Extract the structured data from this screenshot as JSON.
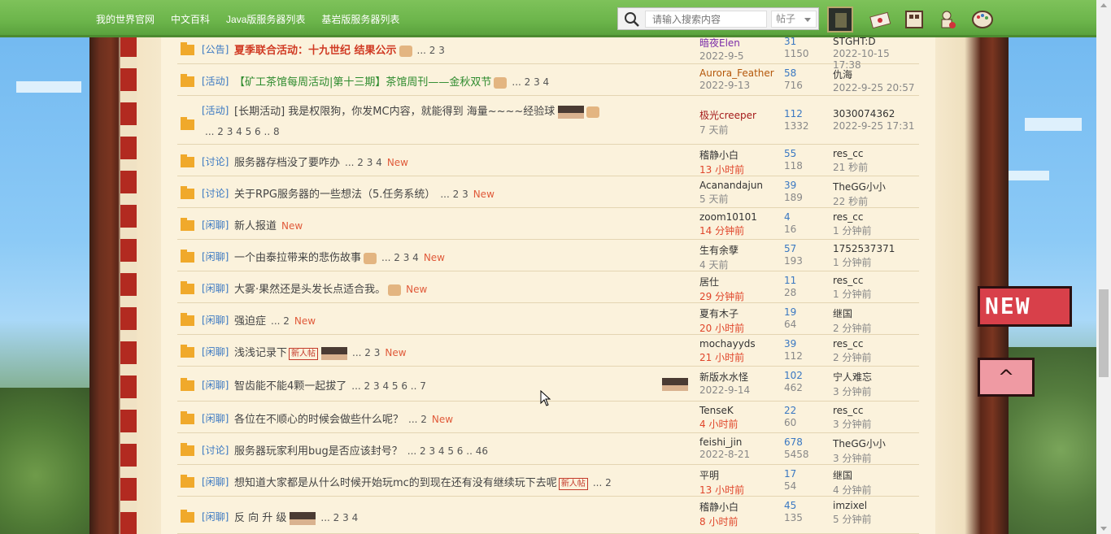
{
  "nav": [
    "我的世界官网",
    "中文百科",
    "Java版服务器列表",
    "基岩版服务器列表"
  ],
  "search": {
    "placeholder": "请输入搜索内容",
    "scope": "帖子"
  },
  "icons": [
    "search-icon",
    "messages-icon",
    "inventory-icon",
    "profile-icon",
    "palette-icon"
  ],
  "flags": {
    "new": "NEW",
    "top": "^"
  },
  "threads": [
    {
      "tag": "[公告]",
      "title": "夏季联合活动：十九世纪 结果公示",
      "style": "red",
      "pages": "... 2 3",
      "author": "暗夜Elen",
      "date": "2022-9-5",
      "replies": "31",
      "views": "1150",
      "last_user": "STGHT:D",
      "last_time": "2022-10-15 17:38"
    },
    {
      "tag": "[活动]",
      "title": "【矿工茶馆每周活动|第十三期】茶馆周刊——金秋双节",
      "style": "green",
      "pages": "... 2 3 4",
      "author": "Aurora_Feather",
      "date": "2022-9-13",
      "replies": "58",
      "views": "716",
      "last_user": "仇海",
      "last_time": "2022-9-25 20:57"
    },
    {
      "tag": "[活动]",
      "title": "[长期活动] 我是权限狗，你发MC内容，就能得到 海量~~~~经验球",
      "style": "",
      "pages": "... 2 3 4 5 6 .. 8",
      "author": "极光creeper",
      "date": "7 天前",
      "replies": "112",
      "views": "1332",
      "last_user": "3030074362",
      "last_time": "2022-9-25 17:31"
    },
    {
      "tag": "[讨论]",
      "title": "服务器存档没了要咋办",
      "style": "",
      "pages": "... 2 3 4",
      "new": "New",
      "author": "稽静小白",
      "date": "13 小时前",
      "replies": "55",
      "views": "118",
      "last_user": "res_cc",
      "last_time": "21 秒前"
    },
    {
      "tag": "[讨论]",
      "title": "关于RPG服务器的一些想法（5.任务系统）",
      "style": "",
      "pages": "... 2 3",
      "new": "New",
      "author": "Acanandajun",
      "date": "5 天前",
      "replies": "39",
      "views": "189",
      "last_user": "TheGG小小",
      "last_time": "22 秒前"
    },
    {
      "tag": "[闲聊]",
      "title": "新人报道",
      "style": "",
      "pages": "",
      "new": "New",
      "author": "zoom10101",
      "date": "14 分钟前",
      "replies": "4",
      "views": "16",
      "last_user": "res_cc",
      "last_time": "1 分钟前"
    },
    {
      "tag": "[闲聊]",
      "title": "一个由泰拉带来的悲伤故事",
      "style": "",
      "pages": "... 2 3 4",
      "new": "New",
      "author": "生有余孽",
      "date": "4 天前",
      "replies": "57",
      "views": "193",
      "last_user": "1752537371",
      "last_time": "1 分钟前"
    },
    {
      "tag": "[闲聊]",
      "title": "大雾·果然还是头发长点适合我。",
      "style": "",
      "pages": "",
      "new": "New",
      "author": "居仕",
      "date": "29 分钟前",
      "replies": "11",
      "views": "28",
      "last_user": "res_cc",
      "last_time": "1 分钟前"
    },
    {
      "tag": "[闲聊]",
      "title": "强迫症",
      "style": "",
      "pages": "... 2",
      "new": "New",
      "author": "夏有木子",
      "date": "20 小时前",
      "replies": "19",
      "views": "64",
      "last_user": "继国",
      "last_time": "2 分钟前"
    },
    {
      "tag": "[闲聊]",
      "title": "浅浅记录下",
      "style": "",
      "pages": "... 2 3",
      "new": "New",
      "newpost": "新人帖",
      "author": "mochayyds",
      "date": "21 小时前",
      "replies": "39",
      "views": "112",
      "last_user": "res_cc",
      "last_time": "2 分钟前"
    },
    {
      "tag": "[闲聊]",
      "title": "智齿能不能4颗一起拔了",
      "style": "",
      "pages": "... 2 3 4 5 6 .. 7",
      "author": "新版水水怪",
      "date": "2022-9-14",
      "replies": "102",
      "views": "462",
      "last_user": "宁人难忘",
      "last_time": "3 分钟前"
    },
    {
      "tag": "[闲聊]",
      "title": "各位在不顺心的时候会做些什么呢？",
      "style": "",
      "pages": "... 2",
      "new": "New",
      "author": "TenseK",
      "date": "4 小时前",
      "replies": "22",
      "views": "60",
      "last_user": "res_cc",
      "last_time": "3 分钟前"
    },
    {
      "tag": "[讨论]",
      "title": "服务器玩家利用bug是否应该封号？",
      "style": "",
      "pages": "... 2 3 4 5 6 .. 46",
      "author": "feishi_jin",
      "date": "2022-8-21",
      "replies": "678",
      "views": "5458",
      "last_user": "TheGG小小",
      "last_time": "3 分钟前"
    },
    {
      "tag": "[闲聊]",
      "title": "想知道大家都是从什么时候开始玩mc的到现在还有没有继续玩下去呢",
      "style": "",
      "pages": "... 2",
      "newpost": "新人帖",
      "author": "平明",
      "date": "13 小时前",
      "replies": "17",
      "views": "54",
      "last_user": "继国",
      "last_time": "4 分钟前"
    },
    {
      "tag": "[闲聊]",
      "title": "反 向 升 级",
      "style": "",
      "pages": "... 2 3 4",
      "author": "稽静小白",
      "date": "8 小时前",
      "replies": "45",
      "views": "135",
      "last_user": "imzixel",
      "last_time": "5 分钟前"
    }
  ]
}
